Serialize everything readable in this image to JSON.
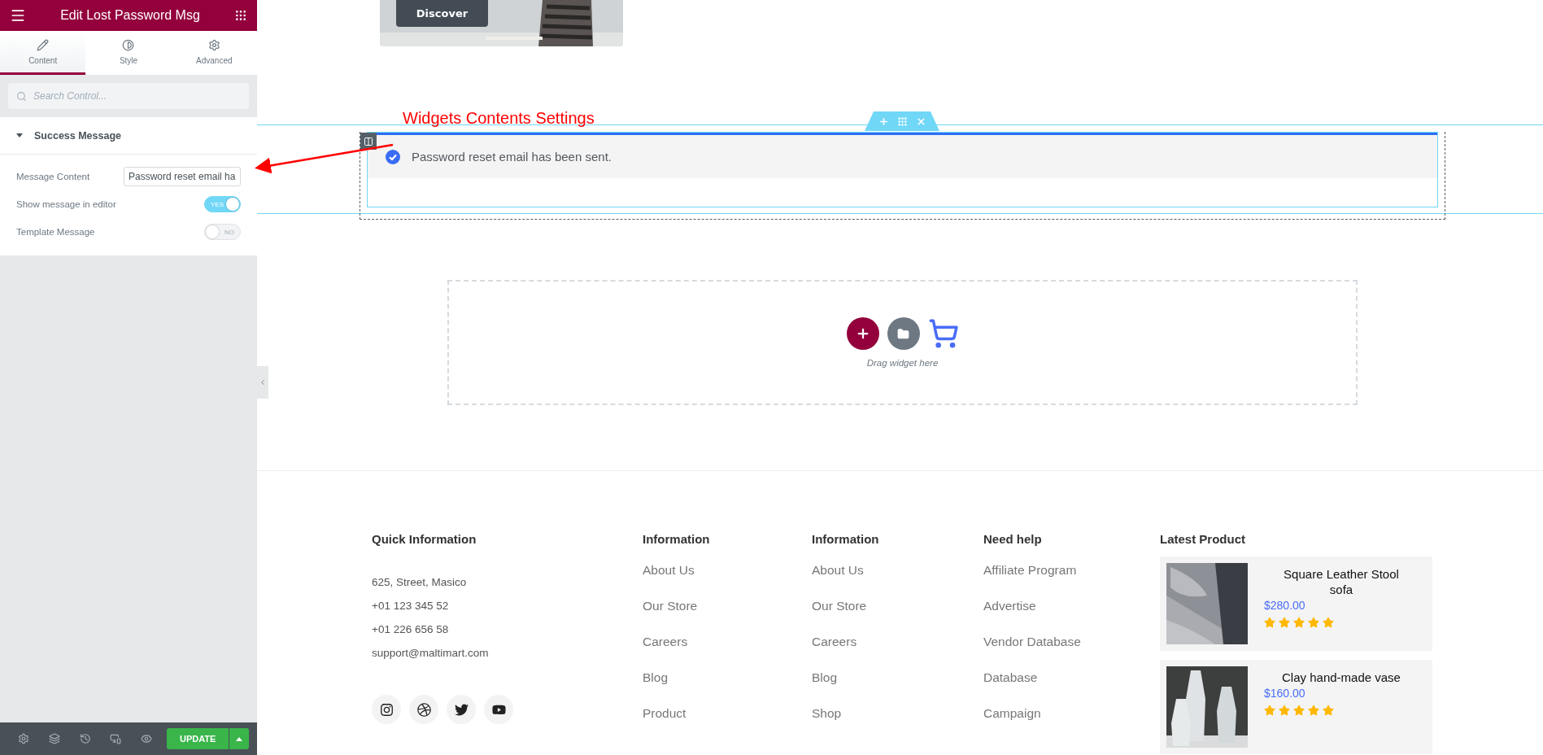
{
  "panel": {
    "title": "Edit Lost Password Msg",
    "tabs": [
      {
        "label": "Content",
        "selected": true
      },
      {
        "label": "Style",
        "selected": false
      },
      {
        "label": "Advanced",
        "selected": false
      }
    ],
    "search": {
      "placeholder": "Search Control..."
    },
    "section": {
      "title": "Success Message",
      "expanded": true
    },
    "controls": [
      {
        "kind": "text",
        "label": "Message Content",
        "value": "Password reset email ha"
      },
      {
        "kind": "switch",
        "label": "Show message in editor",
        "on": true,
        "switch_text": "YES"
      },
      {
        "kind": "switch",
        "label": "Template Message",
        "on": false,
        "switch_text": "NO"
      }
    ],
    "update_button": "UPDATE"
  },
  "hero": {
    "button": "Discover"
  },
  "annotation": "Widgets Contents Settings",
  "widget": {
    "message": "Password reset email has been sent."
  },
  "drop_zone": {
    "hint": "Drag widget here"
  },
  "footer": {
    "contact": {
      "heading": "Quick Information",
      "lines": [
        "625, Street, Masico",
        "+01 123 345 52",
        "+01 226 656 58",
        "support@maltimart.com"
      ]
    },
    "link_columns": [
      {
        "heading": "Information",
        "links": [
          "About Us",
          "Our Store",
          "Careers",
          "Blog",
          "Product"
        ]
      },
      {
        "heading": "Information",
        "links": [
          "About Us",
          "Our Store",
          "Careers",
          "Blog",
          "Shop"
        ]
      },
      {
        "heading": "Need help",
        "links": [
          "Affiliate Program",
          "Advertise",
          "Vendor Database",
          "Database",
          "Campaign"
        ]
      }
    ],
    "latest": {
      "heading": "Latest Product",
      "products": [
        {
          "name": "Square Leather Stool sofa",
          "price": "$280.00",
          "stars": 5
        },
        {
          "name": "Clay hand-made vase",
          "price": "$160.00",
          "stars": 5
        }
      ]
    }
  }
}
